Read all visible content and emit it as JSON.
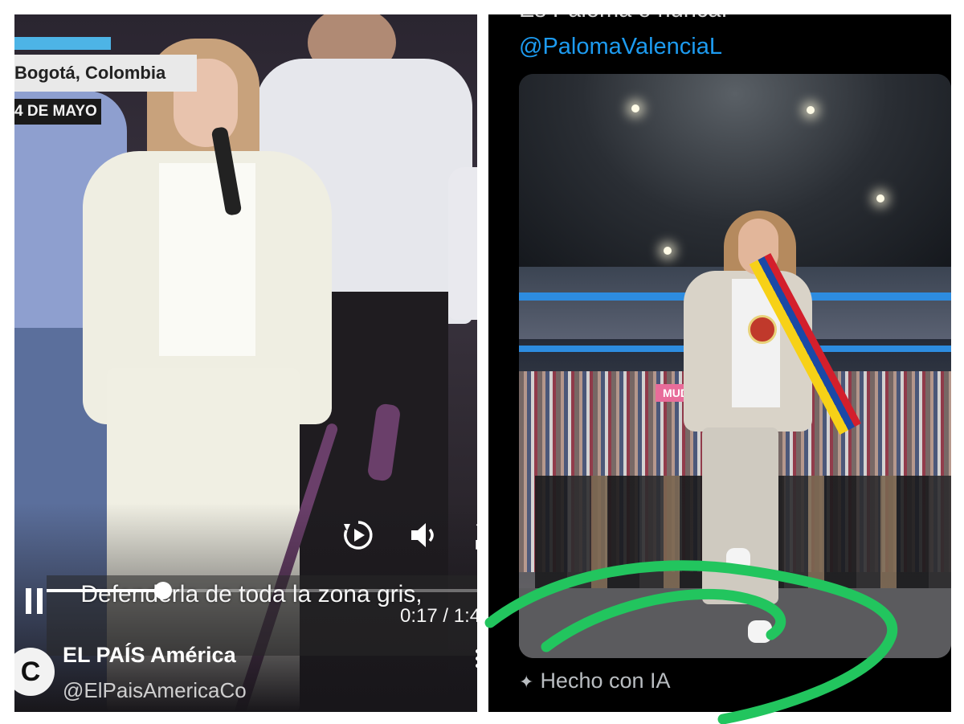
{
  "left_video": {
    "location": "Bogotá, Colombia",
    "date": "4 DE MAYO",
    "caption": "Defenderla de toda la zona gris,",
    "time": "0:17 / 1:4",
    "progress_fraction": 0.26,
    "channel_name": "EL PAÍS América",
    "channel_handle": "@ElPaisAmericaCo",
    "avatar_letter": "C",
    "icons": [
      "replay-icon",
      "volume-icon",
      "collapse-icon",
      "pause-icon",
      "more-icon"
    ]
  },
  "right_post": {
    "text_cut": "Es Paloma o nunca.",
    "mention": "@PalomaValenciaL",
    "crowd_sign": "MUD",
    "ai_label": "Hecho con IA",
    "icons": [
      "sparkle-icon"
    ],
    "link_color": "#1d9bf0"
  },
  "annotation": {
    "scribble_color": "#22c55e"
  }
}
